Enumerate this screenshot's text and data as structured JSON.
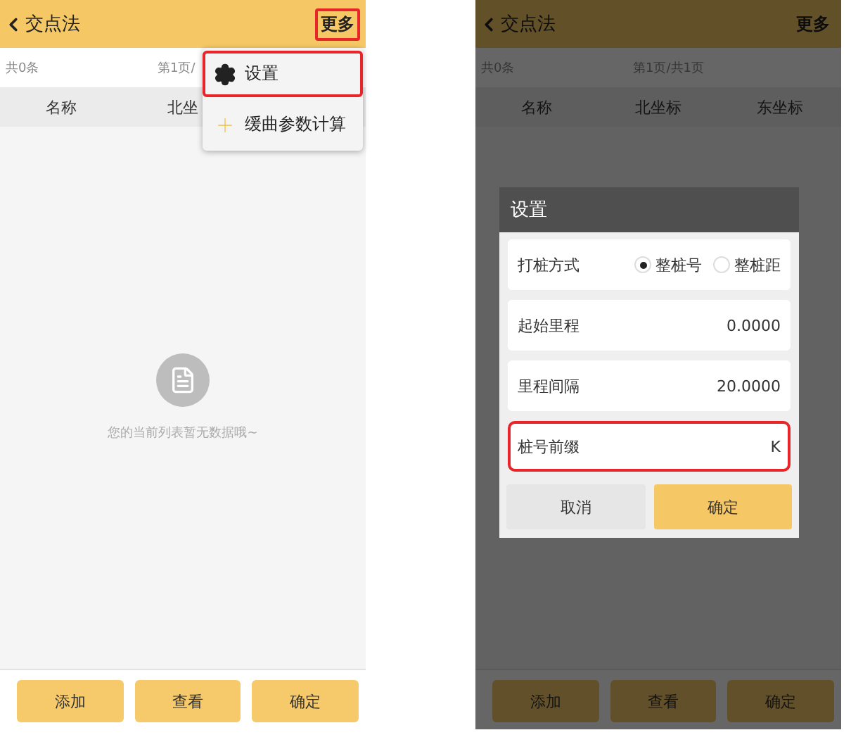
{
  "screens": [
    {
      "header": {
        "title": "交点法",
        "more": "更多",
        "more_highlighted": true
      },
      "summary": {
        "count": "共0条",
        "page": "第1页/"
      },
      "columns": [
        "名称",
        "北坐"
      ],
      "empty_message": "您的当前列表暂无数据哦~",
      "buttons": [
        "添加",
        "查看",
        "确定"
      ],
      "menu": {
        "items": [
          {
            "kind": "settings",
            "label": "设置",
            "highlighted": true
          },
          {
            "kind": "add",
            "label": "缓曲参数计算",
            "highlighted": false
          }
        ]
      }
    },
    {
      "header": {
        "title": "交点法",
        "more": "更多",
        "more_highlighted": false
      },
      "summary": {
        "count": "共0条",
        "page": "第1页/共1页"
      },
      "columns": [
        "名称",
        "北坐标",
        "东坐标"
      ],
      "buttons": [
        "添加",
        "查看",
        "确定"
      ],
      "dialog": {
        "title": "设置",
        "rows": [
          {
            "kind": "radio",
            "label": "打桩方式",
            "options": [
              {
                "label": "整桩号",
                "selected": true
              },
              {
                "label": "整桩距",
                "selected": false
              }
            ],
            "highlighted": false
          },
          {
            "kind": "value",
            "label": "起始里程",
            "value": "0.0000",
            "highlighted": false
          },
          {
            "kind": "value",
            "label": "里程间隔",
            "value": "20.0000",
            "highlighted": false
          },
          {
            "kind": "value",
            "label": "桩号前缀",
            "value": "K",
            "highlighted": true
          }
        ],
        "cancel": "取消",
        "confirm": "确定"
      }
    }
  ]
}
